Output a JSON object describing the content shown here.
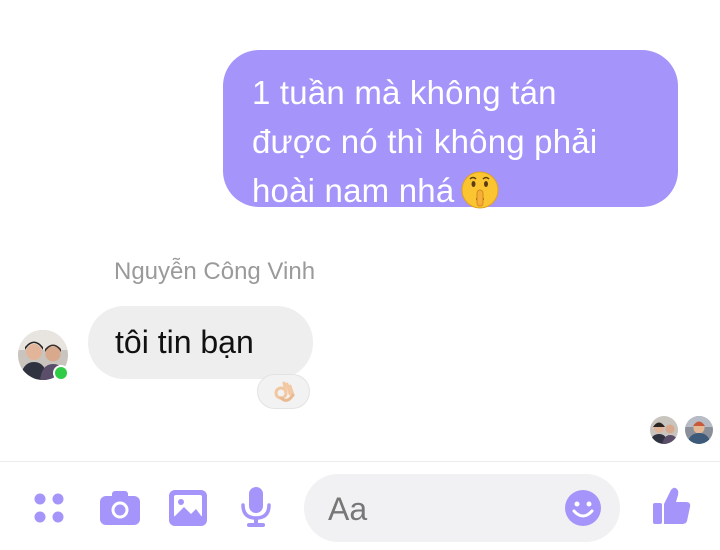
{
  "conversation": {
    "outgoing": {
      "lines": [
        "1 tuần mà không tán",
        "được nó thì không phải",
        "hoài nam nhá"
      ],
      "emoji": "shushing-face-emoji"
    },
    "incoming": {
      "sender_name": "Nguyễn Công Vinh",
      "text": "tôi tin bạn",
      "reaction": "ok-hand-emoji",
      "online": true
    },
    "seen_by_count": 2
  },
  "composer": {
    "placeholder": "Aa",
    "icons": [
      "apps-icon",
      "camera-icon",
      "gallery-icon",
      "microphone-icon",
      "emoji-icon",
      "like-icon"
    ]
  },
  "colors": {
    "accent": "#a594f9",
    "outgoing_bubble": "#a594f9",
    "incoming_bubble": "#eeeeee",
    "online_dot": "#31cc46"
  }
}
